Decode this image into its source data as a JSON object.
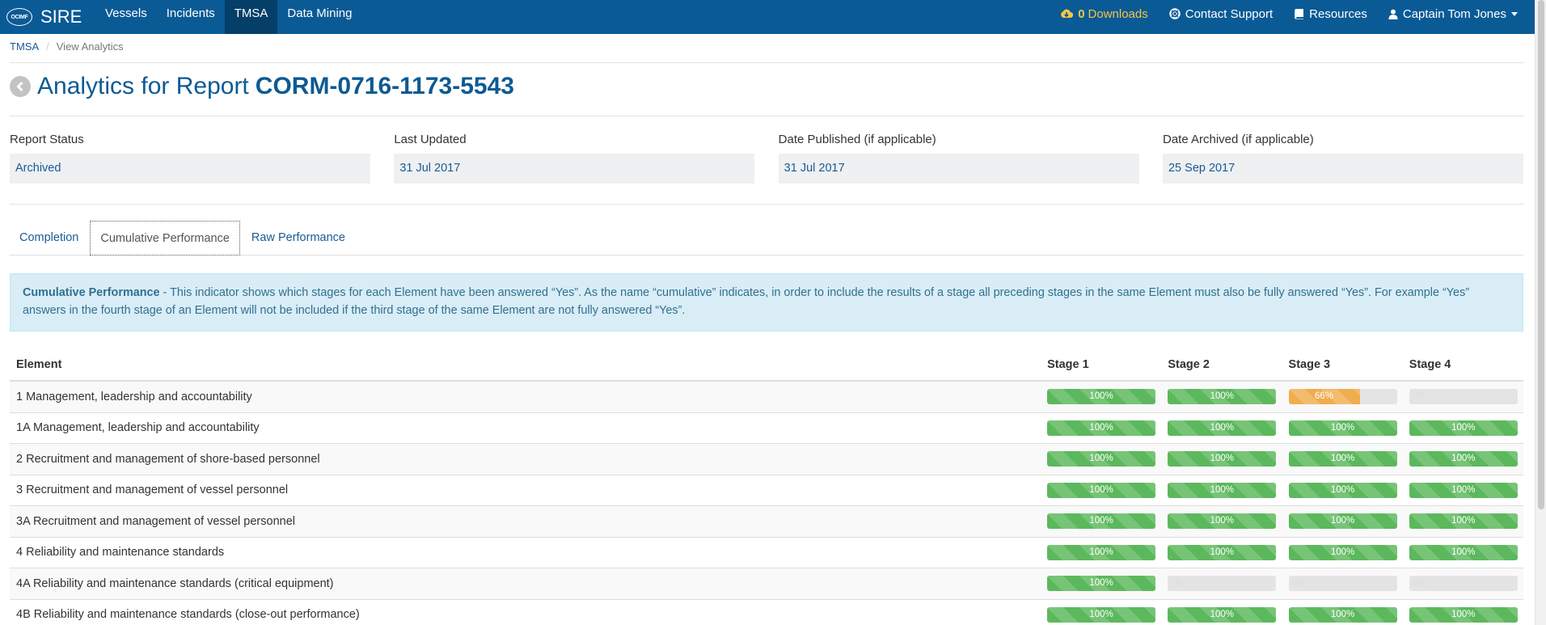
{
  "navbar": {
    "logo_text": "OCIMF",
    "brand": "SIRE",
    "items": [
      {
        "label": "Vessels",
        "active": false
      },
      {
        "label": "Incidents",
        "active": false
      },
      {
        "label": "TMSA",
        "active": true
      },
      {
        "label": "Data Mining",
        "active": false
      }
    ],
    "downloads_count": "0",
    "downloads_label": "Downloads",
    "contact_support": "Contact Support",
    "resources": "Resources",
    "user": "Captain Tom Jones"
  },
  "breadcrumb": {
    "root": "TMSA",
    "current": "View Analytics"
  },
  "title": {
    "prefix": "Analytics for Report",
    "report_id": "CORM-0716-1173-5543"
  },
  "fields": [
    {
      "label": "Report Status",
      "value": "Archived"
    },
    {
      "label": "Last Updated",
      "value": "31 Jul 2017"
    },
    {
      "label": "Date Published (if applicable)",
      "value": "31 Jul 2017"
    },
    {
      "label": "Date Archived (if applicable)",
      "value": "25 Sep 2017"
    }
  ],
  "tabs": [
    {
      "label": "Completion",
      "active": false
    },
    {
      "label": "Cumulative Performance",
      "active": true
    },
    {
      "label": "Raw Performance",
      "active": false
    }
  ],
  "info": {
    "heading": "Cumulative Performance",
    "text": " - This indicator shows which stages for each Element have been answered “Yes”. As the name “cumulative” indicates, in order to include the results of a stage all preceding stages in the same Element must also be fully answered “Yes”. For example “Yes” answers in the fourth stage of an Element will not be included if the third stage of the same Element are not fully answered “Yes”."
  },
  "table": {
    "headers": [
      "Element",
      "Stage 1",
      "Stage 2",
      "Stage 3",
      "Stage 4"
    ],
    "rows": [
      {
        "element": "1 Management, leadership and accountability",
        "stages": [
          100,
          100,
          66,
          0
        ]
      },
      {
        "element": "1A Management, leadership and accountability",
        "stages": [
          100,
          100,
          100,
          100
        ]
      },
      {
        "element": "2 Recruitment and management of shore-based personnel",
        "stages": [
          100,
          100,
          100,
          100
        ]
      },
      {
        "element": "3 Recruitment and management of vessel personnel",
        "stages": [
          100,
          100,
          100,
          100
        ]
      },
      {
        "element": "3A Recruitment and management of vessel personnel",
        "stages": [
          100,
          100,
          100,
          100
        ]
      },
      {
        "element": "4 Reliability and maintenance standards",
        "stages": [
          100,
          100,
          100,
          100
        ]
      },
      {
        "element": "4A Reliability and maintenance standards (critical equipment)",
        "stages": [
          100,
          0,
          0,
          0
        ]
      },
      {
        "element": "4B Reliability and maintenance standards (close-out performance)",
        "stages": [
          100,
          100,
          100,
          100
        ]
      }
    ]
  },
  "colors": {
    "navbar": "#0a5a96",
    "complete": "#5cb85c",
    "partial": "#f0ad4e",
    "empty": "#e4e4e4"
  }
}
